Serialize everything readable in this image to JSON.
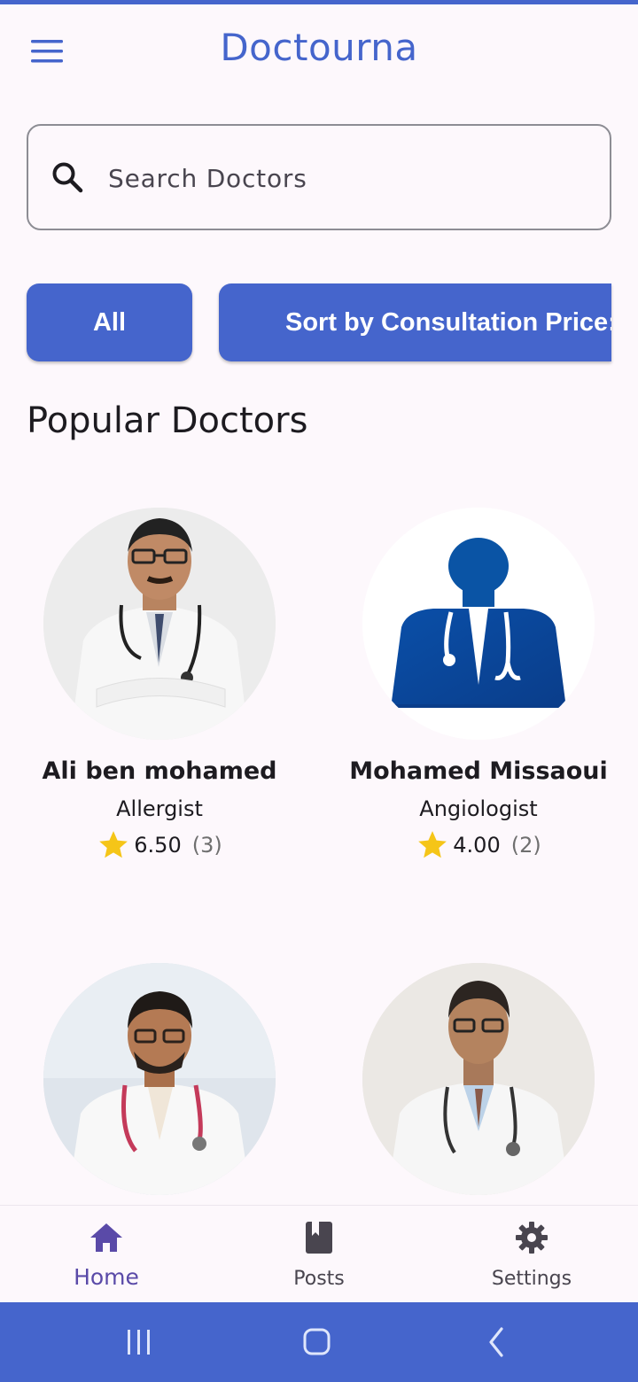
{
  "app": {
    "title": "Doctourna"
  },
  "search": {
    "placeholder": "Search Doctors",
    "value": ""
  },
  "filters": {
    "all_label": "All",
    "sort_label": "Sort by Consultation Price:"
  },
  "section": {
    "title": "Popular Doctors"
  },
  "doctors": [
    {
      "name": "Ali ben mohamed",
      "specialty": "Allergist",
      "rating": "6.50",
      "count": "(3)"
    },
    {
      "name": "Mohamed Missaoui",
      "specialty": "Angiologist",
      "rating": "4.00",
      "count": "(2)"
    },
    {
      "name": "",
      "specialty": "",
      "rating": "",
      "count": ""
    },
    {
      "name": "",
      "specialty": "",
      "rating": "",
      "count": ""
    }
  ],
  "bottom_nav": [
    {
      "label": "Home",
      "icon": "home-icon",
      "active": true
    },
    {
      "label": "Posts",
      "icon": "book-icon",
      "active": false
    },
    {
      "label": "Settings",
      "icon": "gear-icon",
      "active": false
    }
  ],
  "colors": {
    "primary": "#4565cc",
    "star": "#f5c518",
    "nav_active": "#5a4aa8",
    "background": "#fdf8fc"
  }
}
